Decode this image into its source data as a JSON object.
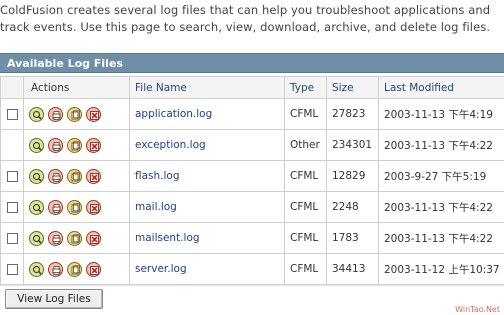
{
  "intro": {
    "text": "ColdFusion creates several log files that can help you troubleshoot applications and track events. Use this page to search, view, download, archive, and delete log files."
  },
  "panel": {
    "title": "Available Log Files"
  },
  "table": {
    "columns": {
      "actions": "Actions",
      "file_name": "File Name",
      "type": "Type",
      "size": "Size",
      "last_modified": "Last Modified"
    },
    "action_icons": [
      "search-icon",
      "print-icon",
      "archive-icon",
      "delete-icon"
    ],
    "rows": [
      {
        "has_checkbox": true,
        "file_name": "application.log",
        "type": "CFML",
        "size": "27823",
        "last_modified": "2003-11-13 下午4:19"
      },
      {
        "has_checkbox": false,
        "file_name": "exception.log",
        "type": "Other",
        "size": "234301",
        "last_modified": "2003-11-13 下午4:22"
      },
      {
        "has_checkbox": true,
        "file_name": "flash.log",
        "type": "CFML",
        "size": "12829",
        "last_modified": "2003-9-27 下午5:19"
      },
      {
        "has_checkbox": true,
        "file_name": "mail.log",
        "type": "CFML",
        "size": "2248",
        "last_modified": "2003-11-13 下午4:22"
      },
      {
        "has_checkbox": true,
        "file_name": "mailsent.log",
        "type": "CFML",
        "size": "1783",
        "last_modified": "2003-11-13 下午4:22"
      },
      {
        "has_checkbox": true,
        "file_name": "server.log",
        "type": "CFML",
        "size": "34413",
        "last_modified": "2003-11-12 上午10:37"
      }
    ]
  },
  "buttons": {
    "view_log_files": "View Log Files"
  },
  "watermark": "WinTao.Net"
}
